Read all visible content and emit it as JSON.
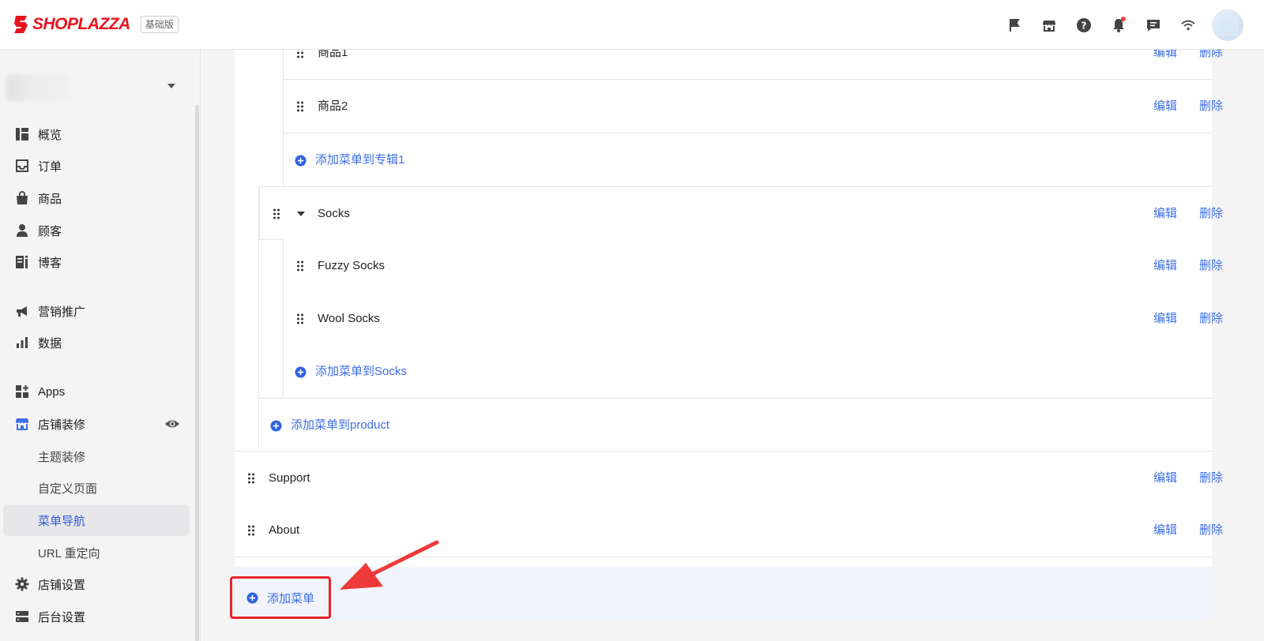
{
  "header": {
    "brand": "SHOPLAZZA",
    "plan_badge": "基础版",
    "icons": [
      "flag-icon",
      "store-icon",
      "help-icon",
      "bell-icon",
      "chat-icon",
      "wifi-icon"
    ],
    "notification_dot_color": "#f04343"
  },
  "sidebar": {
    "store_name": "",
    "items": [
      {
        "label": "概览",
        "icon": "overview-icon"
      },
      {
        "label": "订单",
        "icon": "inbox-icon"
      },
      {
        "label": "商品",
        "icon": "bag-icon"
      },
      {
        "label": "顾客",
        "icon": "person-icon"
      },
      {
        "label": "博客",
        "icon": "blog-icon"
      },
      {
        "label": "营销推广",
        "icon": "megaphone-icon"
      },
      {
        "label": "数据",
        "icon": "bar-chart-icon"
      },
      {
        "label": "Apps",
        "icon": "apps-icon"
      },
      {
        "label": "店铺装修",
        "icon": "storefront-icon"
      },
      {
        "label": "主题装修"
      },
      {
        "label": "自定义页面"
      },
      {
        "label": "菜单导航",
        "active": true
      },
      {
        "label": "URL 重定向"
      },
      {
        "label": "店铺设置",
        "icon": "gear-icon"
      },
      {
        "label": "后台设置",
        "icon": "server-icon"
      }
    ]
  },
  "menu": {
    "edit_label": "编辑",
    "delete_label": "删除",
    "rows": [
      {
        "label": "商品1"
      },
      {
        "label": "商品2"
      },
      {
        "add_label": "添加菜单到专辑1"
      },
      {
        "label": "Socks"
      },
      {
        "label": "Fuzzy Socks"
      },
      {
        "label": "Wool Socks"
      },
      {
        "add_label": "添加菜单到Socks"
      },
      {
        "add_label": "添加菜单到product"
      },
      {
        "label": "Support"
      },
      {
        "label": "About"
      }
    ],
    "add_menu_label": "添加菜单"
  },
  "colors": {
    "brand_red": "#e9121d",
    "link_blue": "#3c6ee6",
    "highlight_red": "#e8262a",
    "active_text": "#2e5bd8"
  }
}
